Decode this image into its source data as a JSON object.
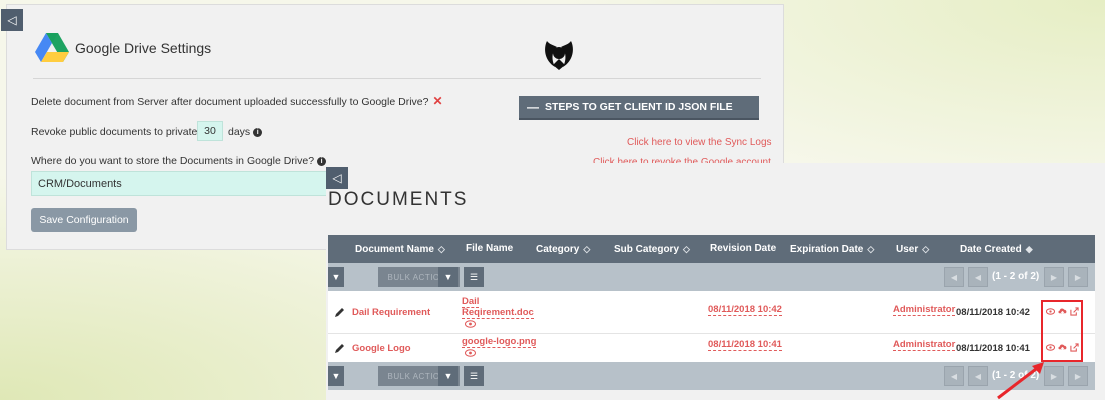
{
  "settings": {
    "title": "Google Drive Settings",
    "delete_question": "Delete document from Server after document uploaded successfully to Google Drive?",
    "revoke_prefix": "Revoke public documents to private in",
    "revoke_days": "30",
    "revoke_suffix": "days",
    "store_question": "Where do you want to store the Documents in Google Drive?",
    "folder_value": "CRM/Documents",
    "save_label": "Save Configuration",
    "steps_label": "STEPS TO GET CLIENT ID JSON FILE",
    "sync_logs_link": "Click here to view the Sync Logs",
    "revoke_link": "Click here to revoke the Google account"
  },
  "documents": {
    "title": "DOCUMENTS",
    "columns": [
      "Document Name",
      "File Name",
      "Category",
      "Sub Category",
      "Revision Date",
      "Expiration Date",
      "User",
      "Date Created"
    ],
    "bulk_action": "BULK ACTION",
    "pagination_top": "(1 - 2 of 2)",
    "pagination_bottom": "(1 - 2 of 2)",
    "rows": [
      {
        "document_name": "Dail Requirement",
        "file_name_line1": "Dail",
        "file_name_line2": "Reqirement.doc",
        "revision_date": "08/11/2018 10:42",
        "user": "Administrator",
        "date_created": "08/11/2018 10:42"
      },
      {
        "document_name": "Google Logo",
        "file_name_line1": "google-logo.png",
        "revision_date": "08/11/2018 10:41",
        "user": "Administrator",
        "date_created": "08/11/2018 10:41"
      }
    ]
  },
  "icons": {
    "collapse": "triangle-left-icon",
    "drive": "google-drive-icon",
    "info": "info-icon",
    "remove": "x-icon",
    "edit": "pencil-icon",
    "preview": "eye-icon",
    "upload": "cloud-upload-icon",
    "share": "share-icon",
    "filter": "filter-icon",
    "columns": "list-icon"
  },
  "colors": {
    "accent_red": "#e05a5a",
    "header_bg": "#5f6c79",
    "input_bg": "#d5f5ee",
    "highlight": "#e8262b"
  }
}
